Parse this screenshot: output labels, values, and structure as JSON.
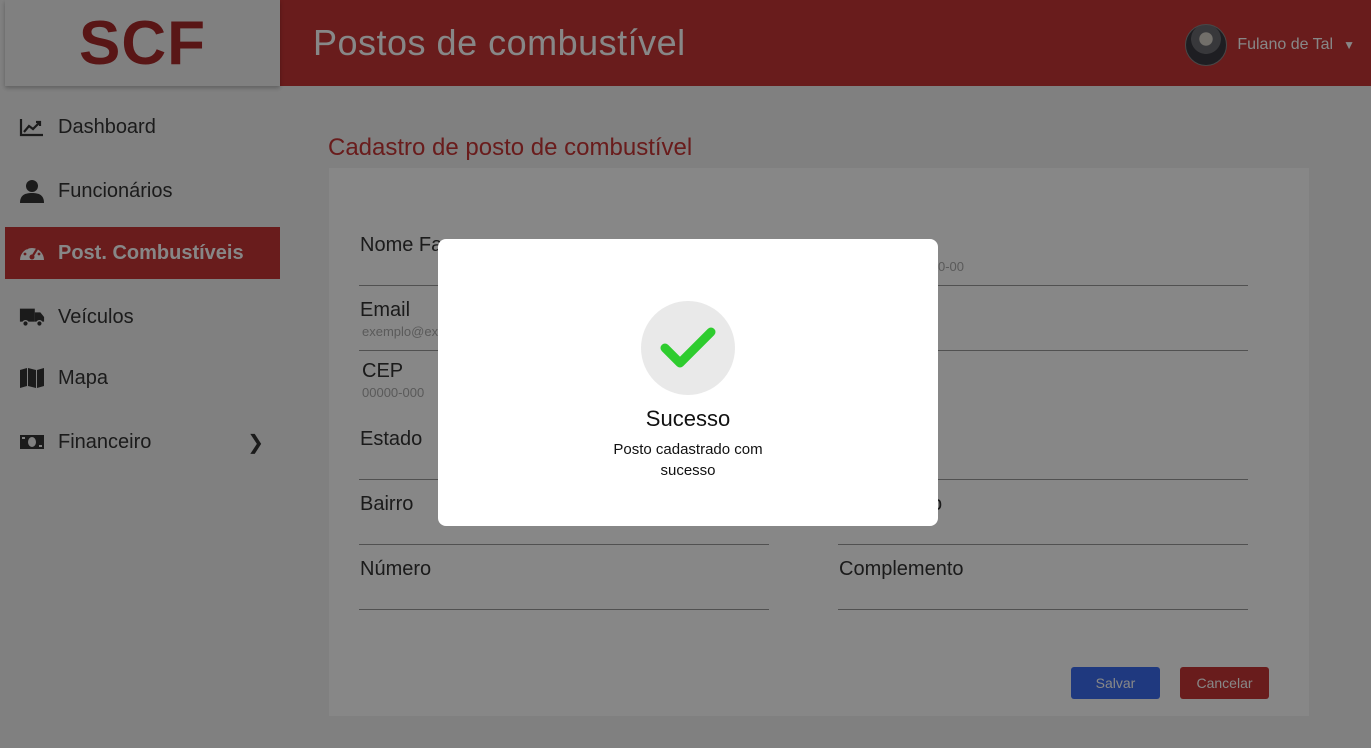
{
  "app": {
    "logo": "SCF",
    "page_title": "Postos de combustível"
  },
  "user": {
    "name": "Fulano de Tal",
    "menu_icon": "caret-down-icon"
  },
  "sidebar": {
    "items": [
      {
        "label": "Dashboard",
        "icon": "chart-line-icon",
        "active": false
      },
      {
        "label": "Funcionários",
        "icon": "user-icon",
        "active": false
      },
      {
        "label": "Post. Combustíveis",
        "icon": "gauge-icon",
        "active": true
      },
      {
        "label": "Veículos",
        "icon": "truck-icon",
        "active": false
      },
      {
        "label": "Mapa",
        "icon": "map-icon",
        "active": false
      },
      {
        "label": "Financeiro",
        "icon": "money-bill-icon",
        "active": false,
        "expand_icon": "❯"
      }
    ]
  },
  "form": {
    "title": "Cadastro de posto de combustível",
    "fields": {
      "nome_fantasia": {
        "label": "Nome Fa",
        "placeholder": ""
      },
      "cnpj": {
        "label": "",
        "placeholder": "0-00"
      },
      "email": {
        "label": "Email",
        "placeholder": "exemplo@ex"
      },
      "telefone": {
        "label": "",
        "placeholder": ""
      },
      "cep": {
        "label": "CEP",
        "placeholder": "00000-000"
      },
      "estado": {
        "label": "Estado",
        "placeholder": ""
      },
      "cidade": {
        "label": "",
        "placeholder": ""
      },
      "bairro": {
        "label": "Bairro",
        "placeholder": ""
      },
      "logradouro": {
        "label": "o",
        "placeholder": ""
      },
      "numero": {
        "label": "Número",
        "placeholder": ""
      },
      "complemento": {
        "label": "Complemento",
        "placeholder": ""
      }
    },
    "save_label": "Salvar",
    "cancel_label": "Cancelar"
  },
  "modal": {
    "icon": "check-icon",
    "title": "Sucesso",
    "message": "Posto cadastrado com sucesso"
  },
  "colors": {
    "brand": "#c63535",
    "save": "#3b6cf0",
    "success": "#2ecc2e"
  }
}
